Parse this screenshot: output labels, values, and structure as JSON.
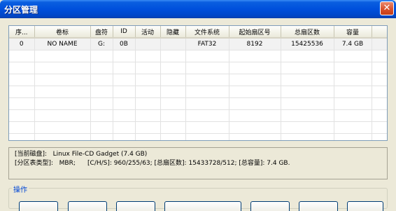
{
  "window": {
    "title": "分区管理",
    "close_glyph": "✕"
  },
  "table": {
    "columns": [
      "序...",
      "卷标",
      "盘符",
      "ID",
      "活动",
      "隐藏",
      "文件系统",
      "起始扇区号",
      "总扇区数",
      "容量"
    ],
    "rows": [
      [
        "0",
        "NO NAME",
        "G:",
        "0B",
        "",
        "",
        "FAT32",
        "8192",
        "15425536",
        "7.4 GB"
      ]
    ]
  },
  "info": {
    "line1": "[当前磁盘]:   Linux File-CD Gadget (7.4 GB)",
    "line2": "[分区表类型]:   MBR;      [C/H/S]: 960/255/63; [总扇区数]: 15433728/512; [总容量]: 7.4 GB."
  },
  "operations": {
    "label": "操作"
  }
}
